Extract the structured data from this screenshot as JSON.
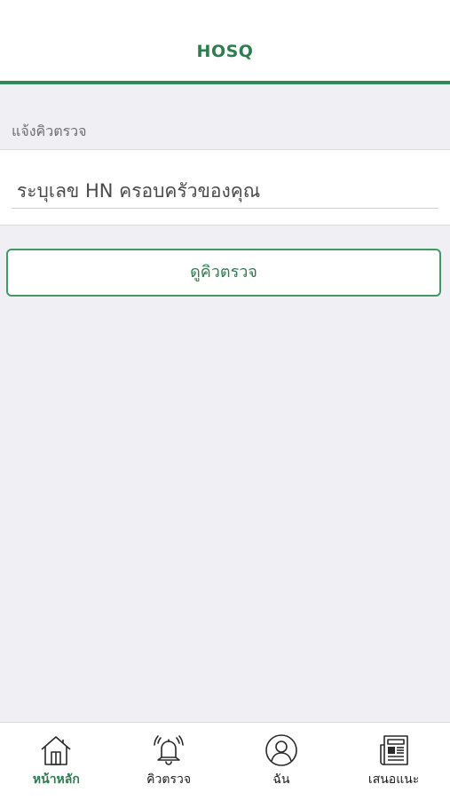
{
  "header": {
    "title": "HOSQ"
  },
  "form": {
    "section_label": "แจ้งคิวตรวจ",
    "hn_placeholder": "ระบุเลข HN ครอบครัวของคุณ",
    "hn_value": "",
    "submit_label": "ดูคิวตรวจ"
  },
  "tabbar": {
    "items": [
      {
        "label": "หน้าหลัก",
        "icon": "home-icon",
        "active": true
      },
      {
        "label": "คิวตรวจ",
        "icon": "bell-icon",
        "active": false
      },
      {
        "label": "ฉัน",
        "icon": "user-icon",
        "active": false
      },
      {
        "label": "เสนอแนะ",
        "icon": "newspaper-icon",
        "active": false
      }
    ]
  },
  "colors": {
    "brand": "#2e7d4f",
    "accent_line": "#2e8b57",
    "background": "#efeff4"
  }
}
